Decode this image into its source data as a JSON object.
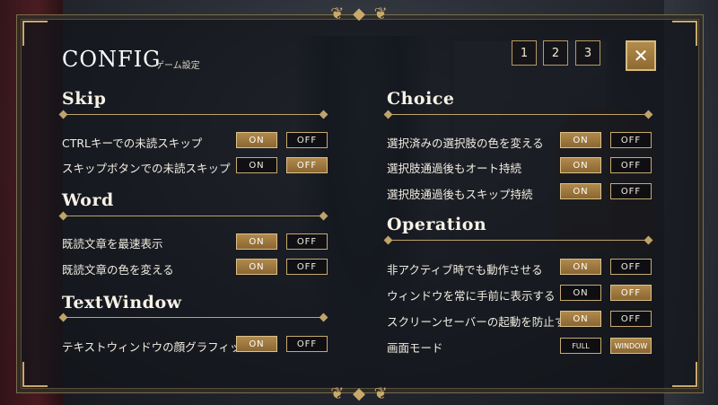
{
  "header": {
    "title": "CONFIG",
    "subtitle": "ゲーム設定",
    "pages": [
      "1",
      "2",
      "3"
    ],
    "close_label": "✕"
  },
  "options": {
    "on": "ON",
    "off": "OFF",
    "full": "FULL",
    "window": "WINDOW"
  },
  "sections": {
    "skip": {
      "title": "Skip",
      "rows": [
        {
          "label": "CTRLキーでの未読スキップ",
          "selected": "on"
        },
        {
          "label": "スキップボタンでの未読スキップ",
          "selected": "off"
        }
      ]
    },
    "word": {
      "title": "Word",
      "rows": [
        {
          "label": "既読文章を最速表示",
          "selected": "on"
        },
        {
          "label": "既読文章の色を変える",
          "selected": "on"
        }
      ]
    },
    "textwindow": {
      "title": "TextWindow",
      "rows": [
        {
          "label": "テキストウィンドウの顔グラフィック",
          "selected": "on"
        }
      ]
    },
    "choice": {
      "title": "Choice",
      "rows": [
        {
          "label": "選択済みの選択肢の色を変える",
          "selected": "on"
        },
        {
          "label": "選択肢通過後もオート持続",
          "selected": "on"
        },
        {
          "label": "選択肢通過後もスキップ持続",
          "selected": "on"
        }
      ]
    },
    "operation": {
      "title": "Operation",
      "rows": [
        {
          "label": "非アクティブ時でも動作させる",
          "selected": "on"
        },
        {
          "label": "ウィンドウを常に手前に表示する",
          "selected": "off"
        },
        {
          "label": "スクリーンセーバーの起動を防止する",
          "selected": "on"
        }
      ],
      "screen_mode": {
        "label": "画面モード",
        "selected": "window"
      }
    }
  }
}
